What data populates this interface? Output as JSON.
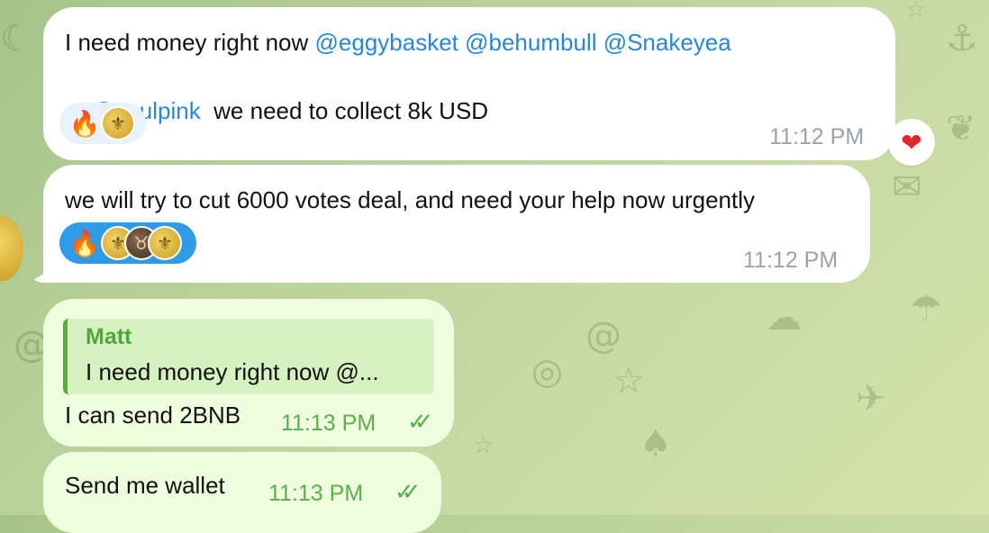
{
  "messages": [
    {
      "type": "incoming",
      "line1_prefix": "I need money right now ",
      "line1_mentions": "@eggybasket @behumbull @Snakeyea",
      "line2_mention": "@saulpink",
      "line2_text": "  we need to collect 8k USD",
      "time": "11:12 PM",
      "reactions": [
        "fire-emoji",
        "gold-avatar"
      ],
      "side_reaction": "heart-emoji"
    },
    {
      "type": "incoming",
      "text": "we will try to cut 6000 votes deal, and need your help now urgently",
      "time": "11:12 PM",
      "reactions": [
        "fire-emoji",
        "gold-avatar",
        "bull-avatar",
        "gold-avatar"
      ]
    },
    {
      "type": "outgoing",
      "reply_name": "Matt",
      "reply_text": "I need money right now @...",
      "text": "I can send 2BNB",
      "time": "11:13 PM",
      "status": "read"
    },
    {
      "type": "outgoing",
      "text": "Send me wallet",
      "time": "11:13 PM",
      "status": "read"
    }
  ],
  "colors": {
    "incoming_bubble": "#ffffff",
    "outgoing_bubble": "#eefedf",
    "mention": "#2a86d3",
    "outgoing_time": "#5cad4d",
    "reply_accent": "#5aad3c"
  }
}
